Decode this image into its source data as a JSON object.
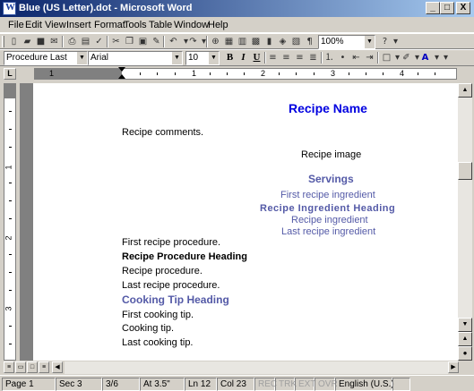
{
  "window": {
    "title": "Blue (US Letter).dot - Microsoft Word",
    "min_label": "_",
    "max_label": "□",
    "close_label": "X"
  },
  "menu": [
    "File",
    "Edit",
    "View",
    "Insert",
    "Format",
    "Tools",
    "Table",
    "Window",
    "Help"
  ],
  "toolbar": {
    "zoom": "100%",
    "style": "Procedure Last",
    "font": "Arial",
    "size": "10",
    "bold": "B",
    "italic": "I",
    "underline": "U"
  },
  "ruler": {
    "corner": "L",
    "numbers": [
      "1",
      "1",
      "2",
      "3",
      "4"
    ],
    "vnumbers": [
      "1",
      "2",
      "3"
    ]
  },
  "document": {
    "title": "Recipe Name",
    "comments": "Recipe comments.",
    "image": "Recipe image",
    "servings": "Servings",
    "first_ingredient": "First recipe ingredient",
    "ingredient_heading": "Recipe Ingredient Heading",
    "ingredient": "Recipe ingredient",
    "last_ingredient": "Last recipe ingredient",
    "first_procedure": "First recipe procedure.",
    "procedure_heading": "Recipe Procedure Heading",
    "procedure": "Recipe procedure.",
    "last_procedure": "Last recipe procedure.",
    "tip_heading": "Cooking Tip Heading",
    "first_tip": "First cooking tip.",
    "tip": "Cooking tip.",
    "last_tip": "Last cooking tip."
  },
  "status": {
    "page": "Page 1",
    "sec": "Sec 3",
    "pages": "3/6",
    "at": "At 3.5\"",
    "ln": "Ln 12",
    "col": "Col 23",
    "rec": "REC",
    "trk": "TRK",
    "ext": "EXT",
    "ovr": "OVR",
    "lang": "English (U.S.)"
  },
  "colors": {
    "title_blue": "#0000e0",
    "heading_purple": "#545aa7",
    "titlebar_start": "#0a246a",
    "titlebar_end": "#a6caf0"
  }
}
